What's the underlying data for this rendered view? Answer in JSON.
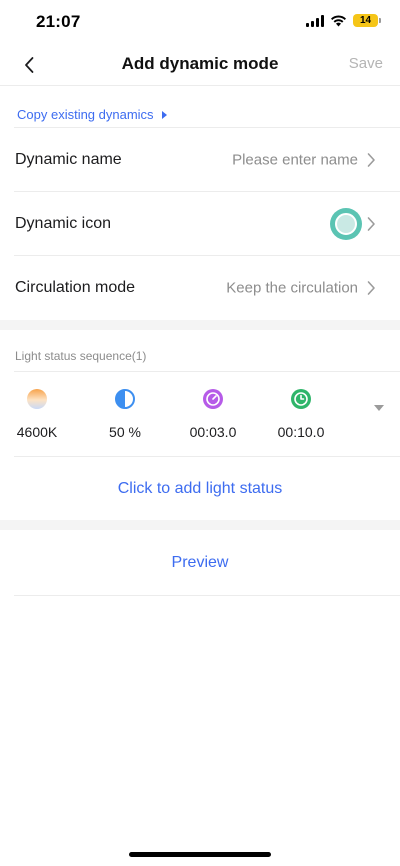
{
  "status_bar": {
    "time": "21:07",
    "battery": "14"
  },
  "nav": {
    "title": "Add dynamic mode",
    "save_label": "Save"
  },
  "copy_existing": {
    "label": "Copy existing dynamics"
  },
  "rows": [
    {
      "label": "Dynamic name",
      "value": "Please enter name"
    },
    {
      "label": "Dynamic icon",
      "value": ""
    },
    {
      "label": "Circulation mode",
      "value": "Keep the circulation"
    }
  ],
  "light_sequence": {
    "title": "Light status sequence(1)",
    "items": [
      {
        "icon": "color-temperature-icon",
        "value": "4600K"
      },
      {
        "icon": "brightness-icon",
        "value": "50 %"
      },
      {
        "icon": "transition-timer-icon",
        "value": "00:03.0"
      },
      {
        "icon": "duration-clock-icon",
        "value": "00:10.0"
      }
    ],
    "add_label": "Click to add light status"
  },
  "preview_label": "Preview",
  "colors": {
    "accent": "#3d6cf0",
    "icon_teal": "#5bc4b3",
    "purple": "#b65be8",
    "green": "#2fb56a",
    "blue": "#3d8ff0"
  }
}
